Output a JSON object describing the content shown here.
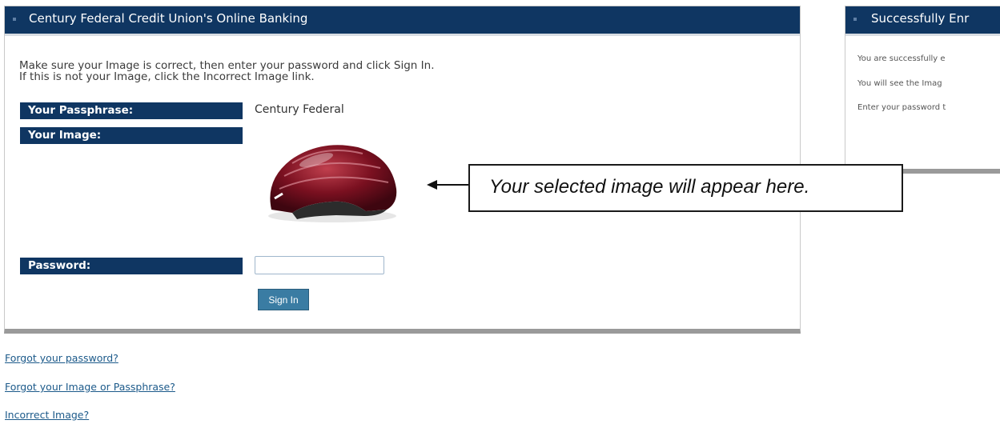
{
  "main_panel": {
    "title": "Century Federal Credit Union's Online Banking",
    "instruction_line1": "Make sure your Image is correct, then enter your password and click Sign In.",
    "instruction_line2": "If this is not your Image, click the Incorrect Image link.",
    "passphrase_label": "Your Passphrase:",
    "passphrase_value": "Century Federal",
    "image_label": "Your Image:",
    "image_icon": "bicycle-helmet",
    "password_label": "Password:",
    "password_value": "",
    "sign_in_label": "Sign In"
  },
  "callout": {
    "text": "Your selected image will appear here."
  },
  "right_panel": {
    "title": "Successfully Enr",
    "lines": [
      "You are successfully e",
      "You will see the Imag",
      "Enter your password t"
    ]
  },
  "links": [
    "Forgot your password?",
    "Forgot your Image or Passphrase?",
    "Incorrect Image?"
  ],
  "colors": {
    "header_navy": "#0f3662",
    "button_blue": "#3a7ca3",
    "link_blue": "#1c5a8a"
  }
}
